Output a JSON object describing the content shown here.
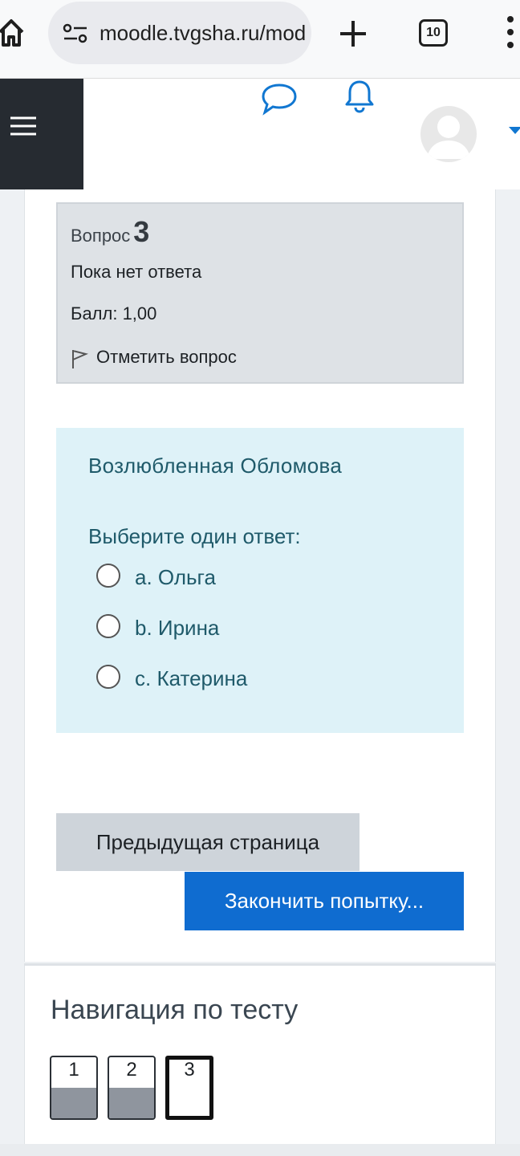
{
  "browser": {
    "url": "moodle.tvgsha.ru/mod/quiz/attempt.php",
    "tab_count": "10"
  },
  "question_info": {
    "label": "Вопрос",
    "number": "3",
    "state": "Пока нет ответа",
    "grade": "Балл: 1,00",
    "flag_label": "Отметить вопрос"
  },
  "question": {
    "text": "Возлюбленная Обломова",
    "prompt": "Выберите один ответ:",
    "answers": [
      {
        "label": "a. Ольга"
      },
      {
        "label": "b. Ирина"
      },
      {
        "label": "c. Катерина"
      }
    ]
  },
  "buttons": {
    "previous": "Предыдущая страница",
    "finish": "Закончить попытку..."
  },
  "quiz_nav": {
    "title": "Навигация по тесту",
    "questions": [
      {
        "num": "1",
        "state": "answered"
      },
      {
        "num": "2",
        "state": "answered"
      },
      {
        "num": "3",
        "state": "current"
      }
    ]
  },
  "colors": {
    "primary": "#0f6cd0",
    "formulation_bg": "#def2f8",
    "info_bg": "#dee2e6",
    "drawer": "#262b31"
  }
}
